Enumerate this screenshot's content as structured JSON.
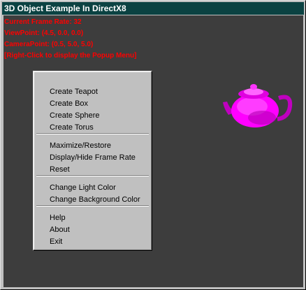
{
  "window": {
    "title": "3D Object Example In DirectX8",
    "background_color": "#3d3d3d",
    "titlebar_color": "#0b4242"
  },
  "info_lines": [
    "Current Frame Rate: 32",
    "ViewPoint: (4.5, 0.0, 0.0)",
    "CameraPoint: (0.5, 5.0, 5.0)",
    "[Right-Click to display the Popup Menu]"
  ],
  "info_color": "#ff0000",
  "object": {
    "type": "teapot",
    "color": "#ff00ff"
  },
  "context_menu": {
    "groups": [
      [
        "Create Teapot",
        "Create Box",
        "Create Sphere",
        "Create Torus"
      ],
      [
        "Maximize/Restore",
        "Display/Hide Frame Rate",
        "Reset"
      ],
      [
        "Change Light Color",
        "Change Background Color"
      ],
      [
        "Help",
        "About",
        "Exit"
      ]
    ]
  }
}
